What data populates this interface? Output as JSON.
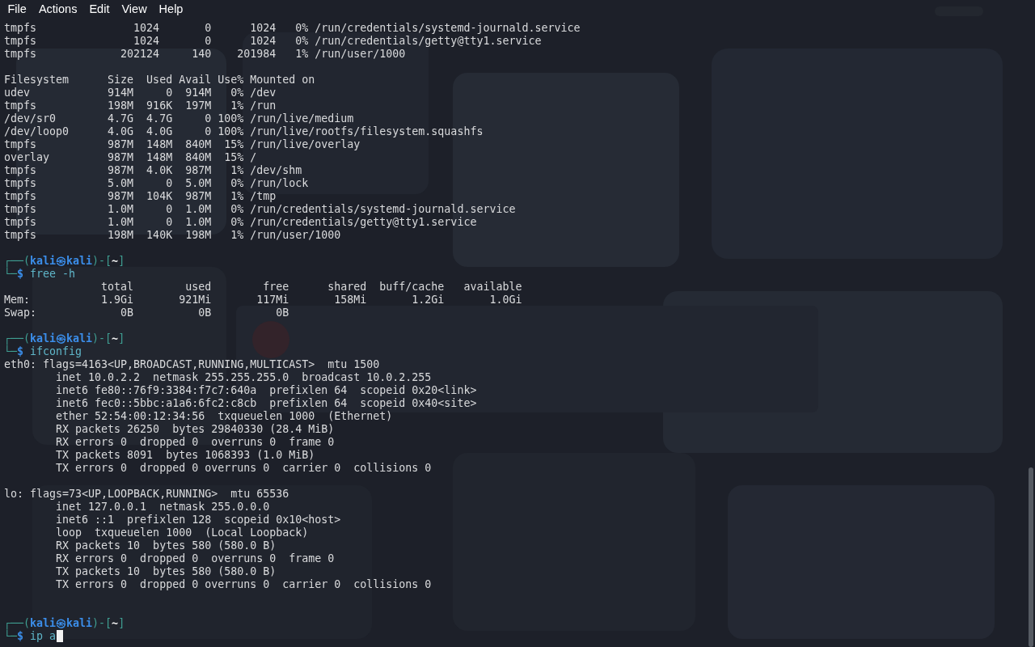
{
  "menu": [
    {
      "label": "File"
    },
    {
      "label": "Actions"
    },
    {
      "label": "Edit"
    },
    {
      "label": "View"
    },
    {
      "label": "Help"
    }
  ],
  "terminal": {
    "lines": [
      {
        "kind": "output",
        "text": "tmpfs               1024       0      1024   0% /run/credentials/systemd-journald.service"
      },
      {
        "kind": "output",
        "text": "tmpfs               1024       0      1024   0% /run/credentials/getty@tty1.service"
      },
      {
        "kind": "output",
        "text": "tmpfs             202124     140    201984   1% /run/user/1000"
      },
      {
        "kind": "blank"
      },
      {
        "kind": "output",
        "text": "Filesystem      Size  Used Avail Use% Mounted on"
      },
      {
        "kind": "output",
        "text": "udev            914M     0  914M   0% /dev"
      },
      {
        "kind": "output",
        "text": "tmpfs           198M  916K  197M   1% /run"
      },
      {
        "kind": "output",
        "text": "/dev/sr0        4.7G  4.7G     0 100% /run/live/medium"
      },
      {
        "kind": "output",
        "text": "/dev/loop0      4.0G  4.0G     0 100% /run/live/rootfs/filesystem.squashfs"
      },
      {
        "kind": "output",
        "text": "tmpfs           987M  148M  840M  15% /run/live/overlay"
      },
      {
        "kind": "output",
        "text": "overlay         987M  148M  840M  15% /"
      },
      {
        "kind": "output",
        "text": "tmpfs           987M  4.0K  987M   1% /dev/shm"
      },
      {
        "kind": "output",
        "text": "tmpfs           5.0M     0  5.0M   0% /run/lock"
      },
      {
        "kind": "output",
        "text": "tmpfs           987M  104K  987M   1% /tmp"
      },
      {
        "kind": "output",
        "text": "tmpfs           1.0M     0  1.0M   0% /run/credentials/systemd-journald.service"
      },
      {
        "kind": "output",
        "text": "tmpfs           1.0M     0  1.0M   0% /run/credentials/getty@tty1.service"
      },
      {
        "kind": "output",
        "text": "tmpfs           198M  140K  198M   1% /run/user/1000"
      },
      {
        "kind": "blank"
      },
      {
        "kind": "prompt",
        "open": "┌──(",
        "user": "kali",
        "at": "㉿",
        "host": "kali",
        "mid": ")-[",
        "dir": "~",
        "close": "]",
        "corner": "└─",
        "sign": "$",
        "command": "free -h",
        "cursor": false
      },
      {
        "kind": "output",
        "text": "               total        used        free      shared  buff/cache   available"
      },
      {
        "kind": "output",
        "text": "Mem:           1.9Gi       921Mi       117Mi       158Mi       1.2Gi       1.0Gi"
      },
      {
        "kind": "output",
        "text": "Swap:             0B          0B          0B"
      },
      {
        "kind": "blank"
      },
      {
        "kind": "prompt",
        "open": "┌──(",
        "user": "kali",
        "at": "㉿",
        "host": "kali",
        "mid": ")-[",
        "dir": "~",
        "close": "]",
        "corner": "└─",
        "sign": "$",
        "command": "ifconfig",
        "cursor": false
      },
      {
        "kind": "output",
        "text": "eth0: flags=4163<UP,BROADCAST,RUNNING,MULTICAST>  mtu 1500"
      },
      {
        "kind": "output",
        "text": "        inet 10.0.2.2  netmask 255.255.255.0  broadcast 10.0.2.255"
      },
      {
        "kind": "output",
        "text": "        inet6 fe80::76f9:3384:f7c7:640a  prefixlen 64  scopeid 0x20<link>"
      },
      {
        "kind": "output",
        "text": "        inet6 fec0::5bbc:a1a6:6fc2:c8cb  prefixlen 64  scopeid 0x40<site>"
      },
      {
        "kind": "output",
        "text": "        ether 52:54:00:12:34:56  txqueuelen 1000  (Ethernet)"
      },
      {
        "kind": "output",
        "text": "        RX packets 26250  bytes 29840330 (28.4 MiB)"
      },
      {
        "kind": "output",
        "text": "        RX errors 0  dropped 0  overruns 0  frame 0"
      },
      {
        "kind": "output",
        "text": "        TX packets 8091  bytes 1068393 (1.0 MiB)"
      },
      {
        "kind": "output",
        "text": "        TX errors 0  dropped 0 overruns 0  carrier 0  collisions 0"
      },
      {
        "kind": "blank"
      },
      {
        "kind": "output",
        "text": "lo: flags=73<UP,LOOPBACK,RUNNING>  mtu 65536"
      },
      {
        "kind": "output",
        "text": "        inet 127.0.0.1  netmask 255.0.0.0"
      },
      {
        "kind": "output",
        "text": "        inet6 ::1  prefixlen 128  scopeid 0x10<host>"
      },
      {
        "kind": "output",
        "text": "        loop  txqueuelen 1000  (Local Loopback)"
      },
      {
        "kind": "output",
        "text": "        RX packets 10  bytes 580 (580.0 B)"
      },
      {
        "kind": "output",
        "text": "        RX errors 0  dropped 0  overruns 0  frame 0"
      },
      {
        "kind": "output",
        "text": "        TX packets 10  bytes 580 (580.0 B)"
      },
      {
        "kind": "output",
        "text": "        TX errors 0  dropped 0 overruns 0  carrier 0  collisions 0"
      },
      {
        "kind": "blank"
      },
      {
        "kind": "blank"
      },
      {
        "kind": "prompt",
        "open": "┌──(",
        "user": "kali",
        "at": "㉿",
        "host": "kali",
        "mid": ")-[",
        "dir": "~",
        "close": "]",
        "corner": "└─",
        "sign": "$",
        "command": "ip a",
        "cursor": true
      }
    ]
  }
}
